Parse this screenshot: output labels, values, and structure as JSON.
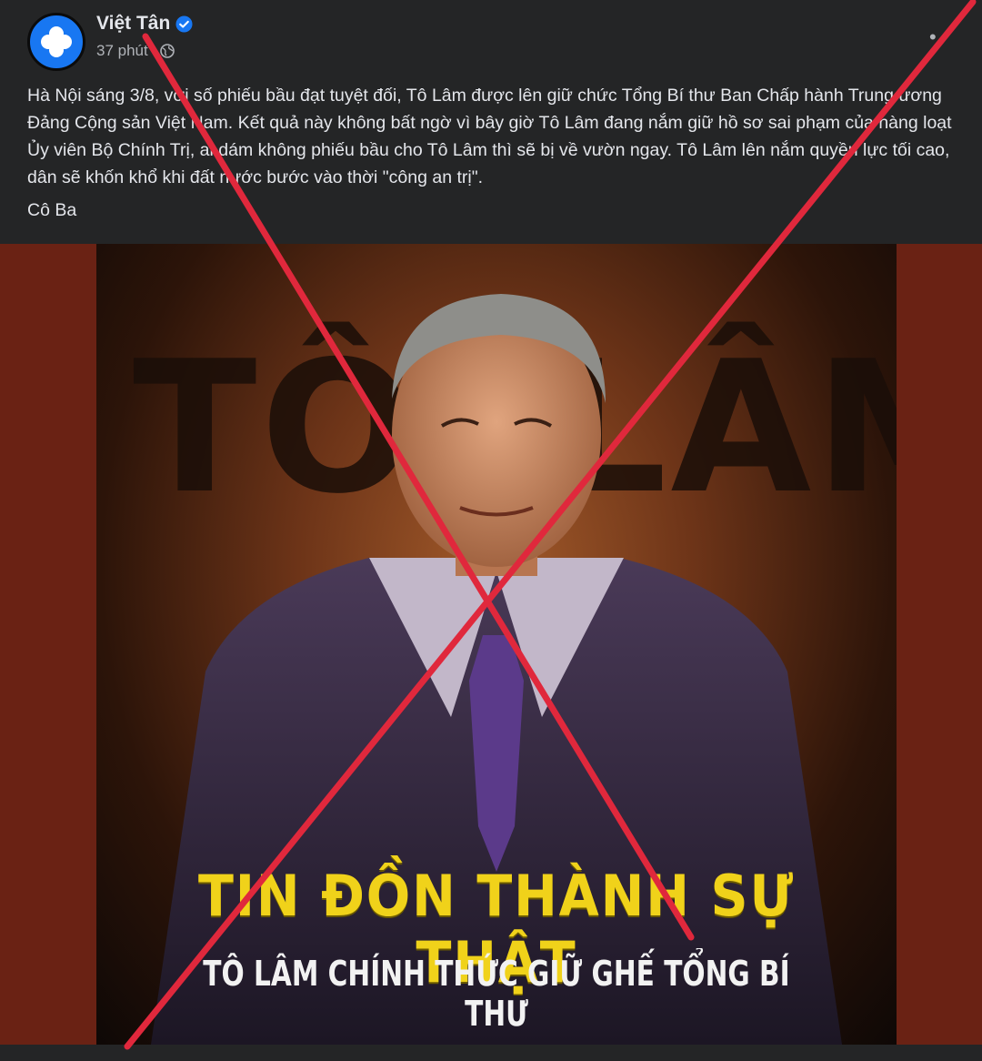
{
  "post": {
    "author": "Việt Tân",
    "time": "37 phút",
    "separator": "·",
    "text": "Hà Nội sáng 3/8, với số phiếu bầu đạt tuyệt đối, Tô Lâm được lên giữ chức Tổng Bí thư Ban Chấp hành Trung ương Đảng Cộng sản Việt Nam. Kết quả này không bất ngờ vì bây giờ Tô Lâm đang nắm giữ hồ sơ sai phạm của hàng loạt Ủy viên Bộ Chính Trị, ai dám không phiếu bầu cho Tô Lâm thì sẽ bị về vườn ngay. Tô Lâm lên nắm quyền lực tối cao, dân sẽ khốn khổ khi đất nước bước vào thời \"công an trị\".",
    "signature": "Cô Ba"
  },
  "poster": {
    "bg_name_left": "TÔ",
    "bg_name_right": "LÂM",
    "headline": "TIN ĐỒN THÀNH SỰ THẬT",
    "subheadline": "TÔ LÂM CHÍNH THỨC GIỮ GHẾ TỔNG BÍ THƯ"
  },
  "icons": {
    "avatar": "flower-logo-icon",
    "verified": "verified-badge-icon",
    "privacy": "globe-icon",
    "more": "more-options-icon"
  },
  "colors": {
    "background": "#242526",
    "text": "#e4e6eb",
    "meta": "#b0b3b8",
    "verified": "#1877f2",
    "media_frame": "#6a2214",
    "headline": "#f0d21a",
    "cross": "#e0283c"
  }
}
